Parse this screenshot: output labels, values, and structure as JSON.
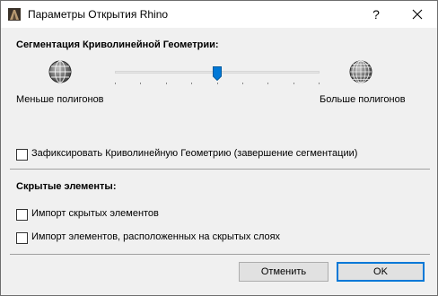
{
  "window": {
    "title": "Параметры Открытия Rhino",
    "help_glyph": "?",
    "app_icon": "rhino-app-icon",
    "close_icon": "close-icon"
  },
  "segmentation": {
    "heading": "Сегментация Криволинейной Геометрии:",
    "left_icon": "globe-low-poly-icon",
    "right_icon": "globe-high-poly-icon",
    "fewer_label": "Меньше полигонов",
    "more_label": "Больше полигонов",
    "slider_value": 0.5,
    "slider_ticks": 9
  },
  "fix_geometry": {
    "label": "Зафиксировать Криволинейную Геометрию (завершение сегментации)",
    "checked": false
  },
  "hidden": {
    "heading": "Скрытые элементы:",
    "import_hidden_label": "Импорт скрытых элементов",
    "import_hidden_checked": false,
    "import_hidden_layers_label": "Импорт элементов, расположенных на скрытых слоях",
    "import_hidden_layers_checked": false
  },
  "buttons": {
    "cancel": "Отменить",
    "ok": "OK"
  },
  "colors": {
    "accent": "#0078d7",
    "dialog_bg": "#f0f0f0"
  }
}
